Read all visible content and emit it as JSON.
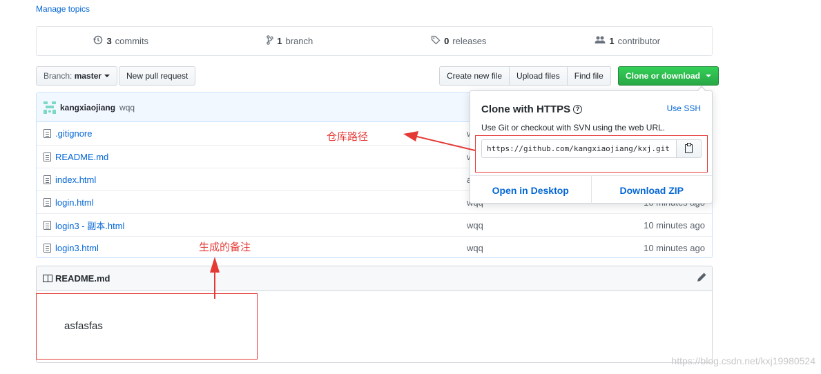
{
  "manage_topics": "Manage topics",
  "summary": [
    {
      "icon": "history-icon",
      "count": "3",
      "label": "commits"
    },
    {
      "icon": "git-branch-icon",
      "count": "1",
      "label": "branch"
    },
    {
      "icon": "tag-icon",
      "count": "0",
      "label": "releases"
    },
    {
      "icon": "people-icon",
      "count": "1",
      "label": "contributor"
    }
  ],
  "toolbar": {
    "branch_prefix": "Branch:",
    "branch_name": "master",
    "new_pull_request": "New pull request",
    "create_new_file": "Create new file",
    "upload_files": "Upload files",
    "find_file": "Find file",
    "clone_or_download": "Clone or download"
  },
  "commit": {
    "author": "kangxiaojiang",
    "message": "wqq"
  },
  "files": [
    {
      "name": ".gitignore",
      "message": "w",
      "age": ""
    },
    {
      "name": "README.md",
      "message": "w",
      "age": ""
    },
    {
      "name": "index.html",
      "message": "a",
      "age": ""
    },
    {
      "name": "login.html",
      "message": "wqq",
      "age": "10 minutes ago"
    },
    {
      "name": "login3 - 副本.html",
      "message": "wqq",
      "age": "10 minutes ago"
    },
    {
      "name": "login3.html",
      "message": "wqq",
      "age": "10 minutes ago"
    }
  ],
  "readme": {
    "title": "README.md",
    "content": "asfasfas"
  },
  "clone": {
    "title": "Clone with HTTPS",
    "use_ssh": "Use SSH",
    "description": "Use Git or checkout with SVN using the web URL.",
    "url": "https://github.com/kangxiaojiang/kxj.git",
    "open_in_desktop": "Open in Desktop",
    "download_zip": "Download ZIP"
  },
  "annotations": {
    "repo_path": "仓库路径",
    "generated_note": "生成的备注"
  },
  "watermark": "https://blog.csdn.net/kxj19980524",
  "colors": {
    "accent": "#0366d6",
    "primary_button": "#28a745",
    "annotation": "#e53935"
  }
}
